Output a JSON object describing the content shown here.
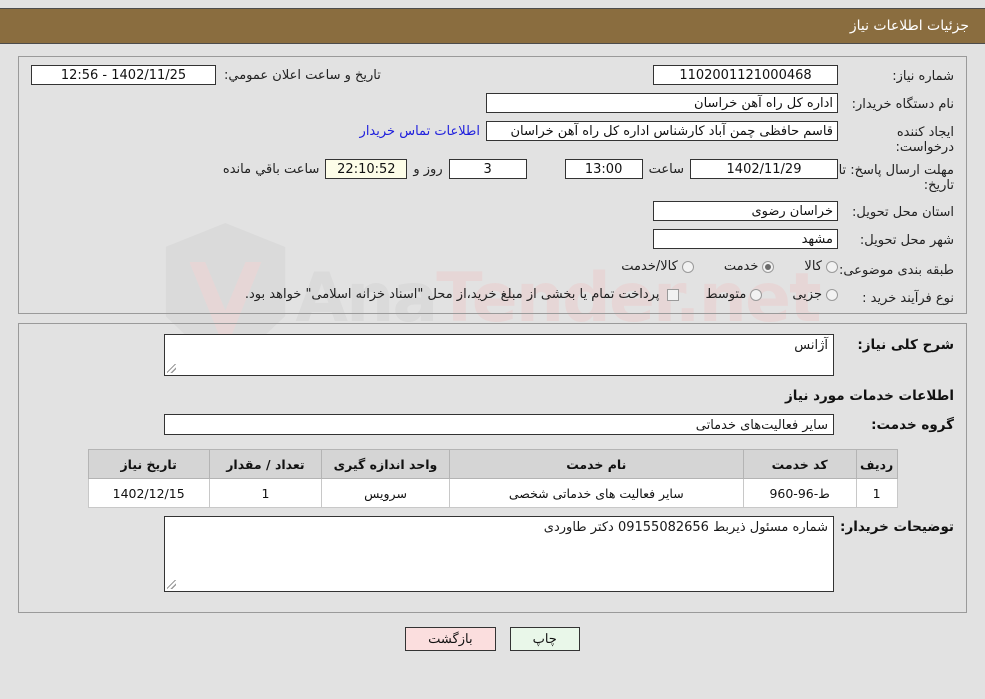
{
  "header": {
    "title": "جزئیات اطلاعات نیاز"
  },
  "form": {
    "need_number_label": "شماره نیاز:",
    "need_number_value": "1102001121000468",
    "buyer_org_label": "نام دستگاه خریدار:",
    "buyer_org_value": "اداره کل راه آهن خراسان",
    "creator_label": "ایجاد کننده درخواست:",
    "creator_value": "قاسم حافظی چمن آباد کارشناس اداره کل راه آهن خراسان",
    "contact_link": "اطلاعات تماس خریدار",
    "deadline_label": "مهلت ارسال پاسخ: تا تاریخ:",
    "deadline_date": "1402/11/29",
    "time_label": "ساعت",
    "deadline_time": "13:00",
    "days_value": "3",
    "days_label": "روز و",
    "remaining_value": "22:10:52",
    "remaining_label": "ساعت باقي مانده",
    "announce_label": "تاریخ و ساعت اعلان عمومي:",
    "announce_value": "1402/11/25 - 12:56",
    "province_label": "استان محل تحویل:",
    "province_value": "خراسان رضوی",
    "city_label": "شهر محل تحویل:",
    "city_value": "مشهد",
    "category_label": "طبقه بندی موضوعی:",
    "category_options": [
      {
        "label": "کالا",
        "selected": false
      },
      {
        "label": "خدمت",
        "selected": true
      },
      {
        "label": "کالا/خدمت",
        "selected": false
      }
    ],
    "process_label": "نوع فرآیند خرید :",
    "process_options": [
      {
        "label": "جزیی",
        "selected": false
      },
      {
        "label": "متوسط",
        "selected": false
      }
    ],
    "payment_checked": false,
    "payment_note": "پرداخت تمام یا بخشی از مبلغ خرید،از محل \"اسناد خزانه اسلامی\" خواهد بود."
  },
  "details": {
    "general_desc_label": "شرح کلی نیاز:",
    "general_desc_value": "آژانس",
    "services_info_title": "اطلاعات خدمات مورد نیاز",
    "service_group_label": "گروه خدمت:",
    "service_group_value": "سایر فعالیت‌های خدماتی",
    "buyer_notes_label": "توضیحات خریدار:",
    "buyer_notes_value": "شماره مسئول ذیربط 09155082656 دکتر طاوردی"
  },
  "table": {
    "headers": [
      "ردیف",
      "کد خدمت",
      "نام خدمت",
      "واحد اندازه گیری",
      "تعداد / مقدار",
      "تاریخ نیاز"
    ],
    "rows": [
      {
        "radif": "1",
        "code": "ط-96-960",
        "name": "سایر فعالیت های خدماتی شخصی",
        "unit": "سرویس",
        "qty": "1",
        "date": "1402/12/15"
      }
    ]
  },
  "footer": {
    "print_label": "چاپ",
    "back_label": "بازگشت"
  },
  "watermark": {
    "text_left": "Ana",
    "text_right": "Tender.net"
  },
  "colors": {
    "header_bg": "#8a6d3f",
    "link": "#2020dd",
    "print_btn": "#e9f7e9",
    "back_btn": "#fbdede",
    "table_header": "#d5d5d5"
  }
}
